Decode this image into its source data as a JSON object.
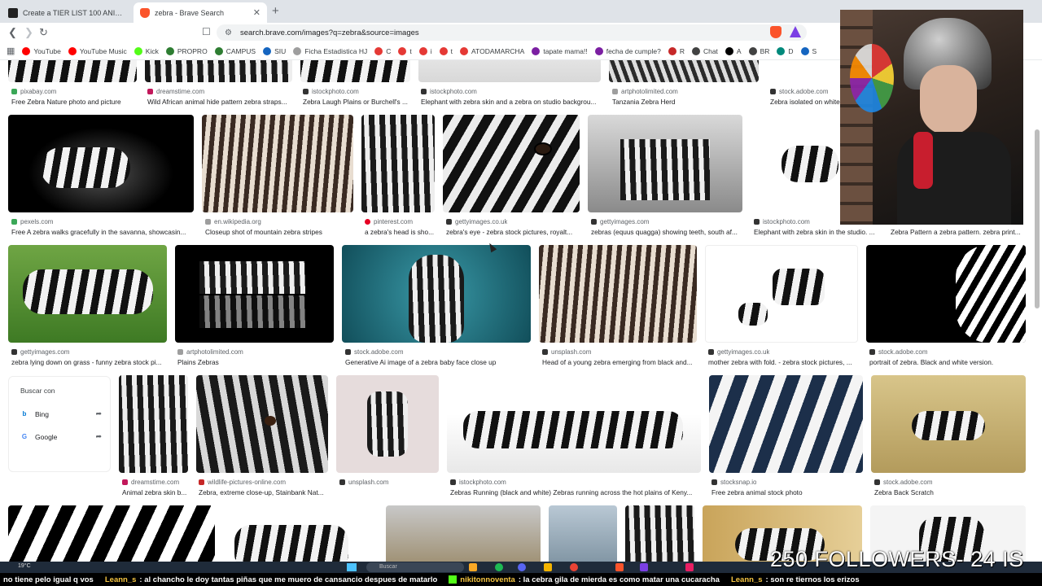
{
  "browser": {
    "tabs": [
      {
        "title": "Create a TIER LIST 100 ANIMALES SU",
        "active": false
      },
      {
        "title": "zebra - Brave Search",
        "active": true
      }
    ],
    "close_glyph": "✕",
    "new_tab_glyph": "+",
    "url": "search.brave.com/images?q=zebra&source=images",
    "bookmarks": [
      "YouTube",
      "YouTube Music",
      "Kick",
      "PROPRO",
      "CAMPUS",
      "SIU",
      "Ficha Estadistica HJ",
      "C",
      "t",
      "i",
      "t",
      "ATODAMARCHA",
      "tapate mama!!",
      "fecha de cumple?",
      "R",
      "Chat",
      "A",
      "BR",
      "D",
      "S"
    ],
    "bookmark_colors": [
      "#ff0000",
      "#ff0000",
      "#53fc18",
      "#2e7d32",
      "#2e7d32",
      "#1565c0",
      "#9e9e9e",
      "#e53935",
      "#e53935",
      "#e53935",
      "#e53935",
      "#e53935",
      "#7b1fa2",
      "#7b1fa2",
      "#c62828",
      "#424242",
      "#000000",
      "#424242",
      "#00897b",
      "#1565c0"
    ]
  },
  "results": {
    "row0": [
      {
        "source": "pixabay.com",
        "caption": "Free Zebra Nature photo and picture",
        "color": "#3aa757"
      },
      {
        "source": "dreamstime.com",
        "caption": "Wild African animal hide pattern zebra straps...",
        "color": "#c2185b"
      },
      {
        "source": "istockphoto.com",
        "caption": "Zebra Laugh Plains or Burchell's ...",
        "color": "#333333"
      },
      {
        "source": "istockphoto.com",
        "caption": "Elephant with zebra skin and a zebra on studio backgrou...",
        "color": "#333333"
      },
      {
        "source": "artphotolimited.com",
        "caption": "Tanzania Zebra Herd",
        "color": "#9e9e9e"
      },
      {
        "source": "stock.adobe.com",
        "caption": "Zebra isolated on white",
        "color": "#333333"
      }
    ],
    "row1": [
      {
        "source": "pexels.com",
        "caption": "Free A zebra walks gracefully in the savanna, showcasin...",
        "color": "#3aa757"
      },
      {
        "source": "en.wikipedia.org",
        "caption": "Closeup shot of mountain zebra stripes",
        "color": "#9e9e9e"
      },
      {
        "source": "pinterest.com",
        "caption": "a zebra's head is sho...",
        "color": "#e60023"
      },
      {
        "source": "gettyimages.co.uk",
        "caption": "zebra's eye - zebra stock pictures, royalt...",
        "color": "#333333"
      },
      {
        "source": "gettyimages.com",
        "caption": "zebras (equus quagga) showing teeth, south af...",
        "color": "#333333"
      },
      {
        "source": "istockphoto.com",
        "caption": "Elephant with zebra skin in the studio. ...",
        "color": "#333333"
      },
      {
        "source": "",
        "caption": "Zebra Pattern a zebra pattern. zebra print...",
        "color": "#333333"
      }
    ],
    "row2": [
      {
        "source": "gettyimages.com",
        "caption": "zebra lying down on grass - funny zebra stock pi...",
        "color": "#333333"
      },
      {
        "source": "artphotolimited.com",
        "caption": "Plains Zebras",
        "color": "#9e9e9e"
      },
      {
        "source": "stock.adobe.com",
        "caption": "Generative Ai image of a zebra baby face close up",
        "color": "#333333"
      },
      {
        "source": "unsplash.com",
        "caption": "Head of a young zebra emerging from black and...",
        "color": "#333333"
      },
      {
        "source": "gettyimages.co.uk",
        "caption": "mother zebra with fold. - zebra stock pictures, ...",
        "color": "#333333"
      },
      {
        "source": "stock.adobe.com",
        "caption": "portrait of zebra. Black and white version.",
        "color": "#333333"
      }
    ],
    "row3": [
      {
        "source": "dreamstime.com",
        "caption": "Animal zebra skin b...",
        "color": "#c2185b"
      },
      {
        "source": "wildlife-pictures-online.com",
        "caption": "Zebra, extreme close-up, Stainbank Nat...",
        "color": "#c62828"
      },
      {
        "source": "unsplash.com",
        "caption": "",
        "color": "#333333"
      },
      {
        "source": "istockphoto.com",
        "caption": "Zebras Running (black and white) Zebras running across the hot plains of Keny...",
        "color": "#333333"
      },
      {
        "source": "stocksnap.io",
        "caption": "Free zebra animal stock photo",
        "color": "#333333"
      },
      {
        "source": "stock.adobe.com",
        "caption": "Zebra Back Scratch",
        "color": "#333333"
      }
    ]
  },
  "search_with": {
    "title": "Buscar con",
    "engines": [
      {
        "name": "Bing",
        "icon": "b",
        "color": "#0078d4"
      },
      {
        "name": "Google",
        "icon": "G",
        "color": "#4285f4"
      }
    ]
  },
  "taskbar": {
    "temperature": "19°C",
    "search_placeholder": "Buscar",
    "app_colors": [
      "#f9a825",
      "#1db954",
      "#5865f2",
      "#f4b400",
      "#ea4335",
      "#fb542b",
      "#7b3fe4",
      "#e91e63"
    ]
  },
  "overlay": {
    "followers": "250 FOLLOWERS- 24 IS",
    "chat": [
      {
        "user": "",
        "message": "no tiene pelo igual q vos"
      },
      {
        "user": "Leann_s",
        "message": "al chancho le doy tantas piñas que me muero de cansancio despues de matarlo"
      },
      {
        "user": "nikitonnoventa",
        "message": "la cebra gila de mierda  es como matar una cucaracha"
      },
      {
        "user": "Leann_s",
        "message": "son re tiernos los erizos"
      }
    ]
  }
}
